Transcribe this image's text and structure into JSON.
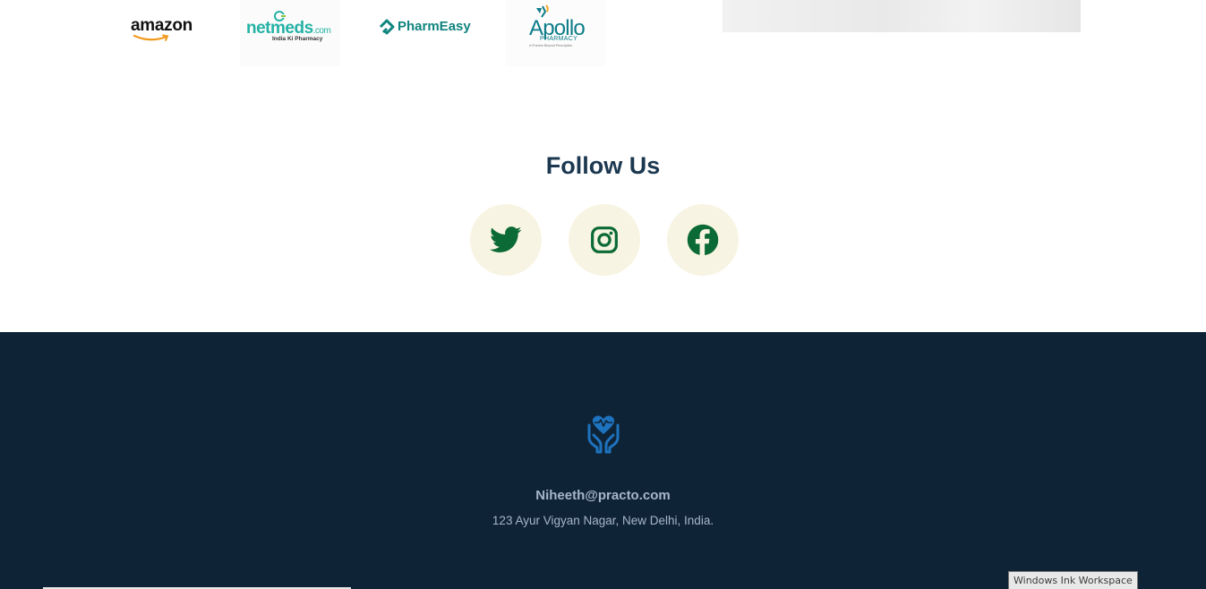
{
  "partners": {
    "amazon": {
      "name": "amazon"
    },
    "netmeds": {
      "name": "netmeds",
      "suffix": ".com",
      "tagline": "India Ki Pharmacy"
    },
    "pharmeasy": {
      "name": "PharmEasy"
    },
    "apollo": {
      "name": "Apollo",
      "sub": "PHARMACY",
      "tagline": "A Promise Beyond Prescription"
    }
  },
  "follow": {
    "title": "Follow Us",
    "socials": [
      {
        "label": "twitter",
        "icon": "twitter-icon"
      },
      {
        "label": "instagram",
        "icon": "instagram-icon"
      },
      {
        "label": "facebook",
        "icon": "facebook-icon"
      }
    ]
  },
  "footer": {
    "logo_icon": "heart-care-hands-icon",
    "email": "Niheeth@practo.com",
    "address": "123 Ayur Vigyan Nagar, New Delhi, India."
  },
  "system": {
    "tooltip": "Windows Ink Workspace"
  },
  "colors": {
    "accent_green": "#0b6a36",
    "social_bg": "#f8f4e3",
    "footer_bg": "#0f2337",
    "footer_text": "#a6b6c8",
    "title_color": "#1b3850",
    "logo_blue": "#1e73be"
  }
}
